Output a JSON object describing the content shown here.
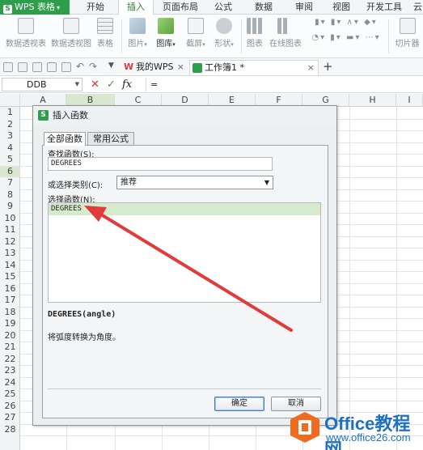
{
  "app": {
    "name": "WPS 表格",
    "logo_glyph": "S"
  },
  "menu_tabs": [
    {
      "label": "开始"
    },
    {
      "label": "插入"
    },
    {
      "label": "页面布局"
    },
    {
      "label": "公式"
    },
    {
      "label": "数据"
    },
    {
      "label": "审阅"
    },
    {
      "label": "视图"
    },
    {
      "label": "开发工具"
    },
    {
      "label": "云"
    }
  ],
  "active_tab": "插入",
  "ribbon": {
    "pivot_table": "数据透视表",
    "pivot_chart": "数据透视图",
    "table": "表格",
    "picture": "图片",
    "gallery": "图库",
    "screenshot": "截屏",
    "shapes": "形状",
    "chart": "图表",
    "online_chart": "在线图表",
    "slicer": "切片器"
  },
  "doc_tabs": [
    {
      "label": "我的WPS",
      "close": "×"
    },
    {
      "label": "工作簿1 *",
      "close": "×"
    }
  ],
  "new_tab": "+",
  "formula_bar": {
    "name_box": "DDB",
    "cancel": "✕",
    "accept": "✓",
    "fx": "fx",
    "content": "="
  },
  "grid": {
    "columns": [
      "A",
      "B",
      "C",
      "D",
      "E",
      "F",
      "G",
      "H",
      "I"
    ],
    "rows": [
      "1",
      "2",
      "3",
      "4",
      "5",
      "6",
      "7",
      "8",
      "9",
      "10",
      "11",
      "12",
      "13",
      "14",
      "15",
      "16",
      "17",
      "18",
      "19",
      "20",
      "21",
      "22",
      "23",
      "24",
      "25",
      "26",
      "27",
      "28"
    ],
    "selected_column": "B",
    "selected_row": "6"
  },
  "dialog": {
    "title": "插入函数",
    "tabs": [
      "全部函数",
      "常用公式"
    ],
    "search_label": "查找函数(S):",
    "search_value": "DEGREES",
    "category_label": "或选择类别(C):",
    "category_value": "推荐",
    "list_label": "选择函数(N):",
    "functions": [
      "DEGREES"
    ],
    "signature": "DEGREES(angle)",
    "description": "将弧度转换为角度。",
    "ok": "确定",
    "cancel": "取消"
  },
  "watermark": {
    "brand": "Office教程网",
    "url": "www.office26.com"
  },
  "colors": {
    "accent_green": "#2e9e4a",
    "selection_green": "#d6ebcd",
    "arrow_red": "#e23b3b",
    "watermark_orange": "#f06a1f",
    "watermark_blue": "#1f6fc2"
  }
}
